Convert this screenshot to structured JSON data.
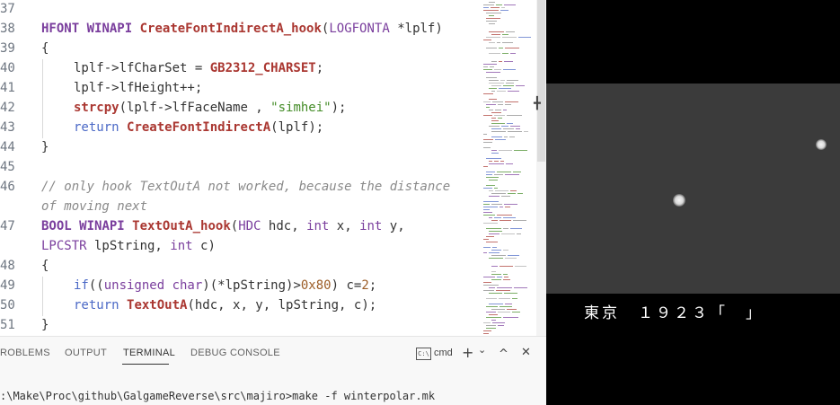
{
  "editor": {
    "line_numbers": [
      "37",
      "38",
      "39",
      "40",
      "41",
      "42",
      "43",
      "44",
      "45",
      "46",
      "47",
      "48",
      "49",
      "50",
      "51"
    ],
    "code": {
      "l38": {
        "kw1": "HFONT",
        "kw2": "WINAPI",
        "fn": "CreateFontIndirectA_hook",
        "p1": "(",
        "ty": "LOGFONTA",
        "rest": " *lplf)"
      },
      "l39": {
        "text": "{"
      },
      "l40": {
        "a": "lplf->lfCharSet = ",
        "macro": "GB2312_CHARSET",
        "b": ";"
      },
      "l41": {
        "a": "lplf->lfHeight++;"
      },
      "l42": {
        "fn": "strcpy",
        "a": "(lplf->lfFaceName , ",
        "str": "\"simhei\"",
        "b": ");"
      },
      "l43": {
        "kw": "return",
        "fn": "CreateFontIndirectA",
        "a": "(lplf);"
      },
      "l44": {
        "text": "}"
      },
      "l46a": {
        "text": "// only hook TextOutA not worked, because the distance"
      },
      "l46b": {
        "text": "of moving next"
      },
      "l47a": {
        "kw1": "BOOL",
        "kw2": "WINAPI",
        "fn": "TextOutA_hook",
        "p1": "(",
        "ty1": "HDC",
        "a": " hdc, ",
        "ty2": "int",
        "b": " x, ",
        "ty3": "int",
        "c": " y,"
      },
      "l47b": {
        "ty1": "LPCSTR",
        "a": " lpString, ",
        "ty2": "int",
        "b": " c)"
      },
      "l48": {
        "text": "{"
      },
      "l49": {
        "kw": "if",
        "a": "((",
        "ty": "unsigned char",
        "b": ")(*lpString)>",
        "num1": "0x80",
        "c": ") c=",
        "num2": "2",
        "d": ";"
      },
      "l50": {
        "kw": "return",
        "fn": "TextOutA",
        "a": "(hdc, x, y, lpString, c);"
      },
      "l51": {
        "text": "}"
      }
    }
  },
  "panel": {
    "tabs": [
      "ROBLEMS",
      "OUTPUT",
      "TERMINAL",
      "DEBUG CONSOLE"
    ],
    "active_tab": "TERMINAL",
    "terminal_icon": "C:\\",
    "terminal_name": "cmd",
    "add_icon": "+",
    "dropdown_icon": "⌄",
    "maximize_icon": "^",
    "close_icon": "✕",
    "terminal_line": ":\\Make\\Proc\\github\\GalgameReverse\\src\\majiro>make -f winterpolar.mk"
  },
  "game": {
    "subtitle": "東京　１９２３「　」"
  },
  "colors": {
    "keyword": "#7a3e9d",
    "function": "#aa3731",
    "string": "#448c27",
    "number": "#9c5d27",
    "comment": "#8a8a8a",
    "game_scene": "#3b3b3b"
  }
}
